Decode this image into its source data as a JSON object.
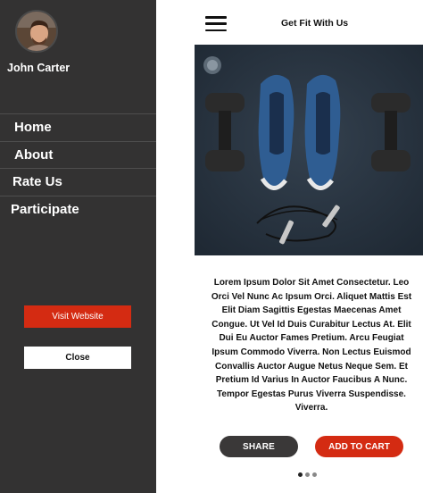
{
  "drawer": {
    "user_name": "John Carter",
    "menu": [
      "Home",
      "About",
      "Rate Us",
      "Participate"
    ],
    "visit_label": "Visit Website",
    "close_label": "Close"
  },
  "header": {
    "menu_icon": "hamburger-icon",
    "title": "Get Fit With Us"
  },
  "product": {
    "image": "sneakers-dumbbells-jump-rope-photo",
    "description": "Lorem Ipsum Dolor Sit Amet Consectetur. Leo Orci Vel Nunc Ac Ipsum Orci. Aliquet Mattis Est Elit Diam Sagittis Egestas Maecenas Amet Congue. Ut Vel Id Duis Curabitur Lectus At. Elit Dui Eu Auctor Fames Pretium. Arcu Feugiat Ipsum Commodo Viverra. Non Lectus Euismod Convallis Auctor Augue Netus Neque Sem. Et Pretium Id Varius In Auctor Faucibus A Nunc. Tempor Egestas Purus Viverra Suspendisse. Viverra.",
    "share_label": "SHARE",
    "cart_label": "ADD TO CART"
  },
  "carousel": {
    "total": 3,
    "active": 1
  },
  "colors": {
    "drawer_bg": "#333232",
    "accent": "#d42b12",
    "share_bg": "#3a3838"
  }
}
